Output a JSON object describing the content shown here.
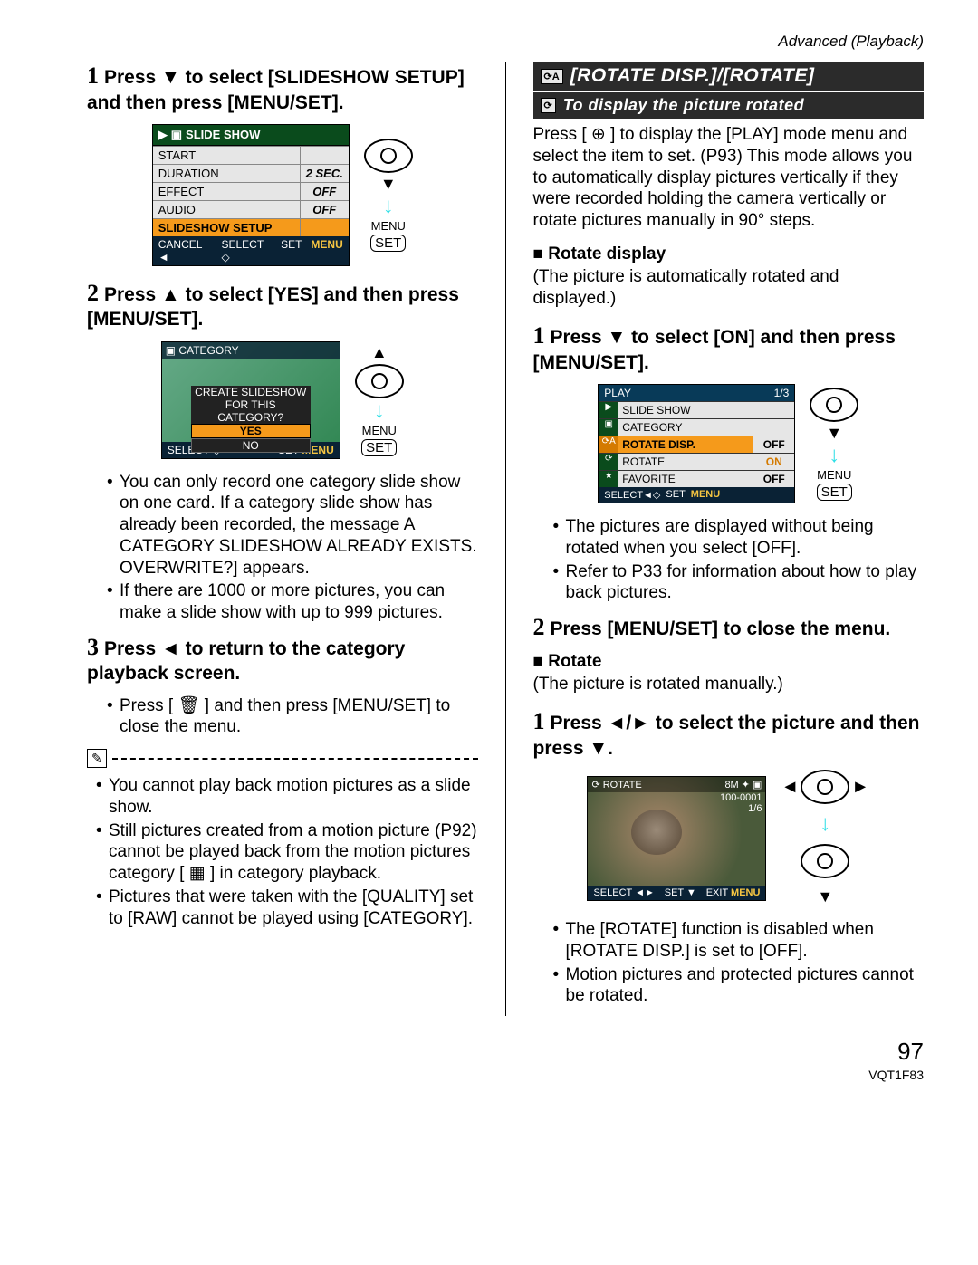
{
  "header": {
    "section": "Advanced (Playback)"
  },
  "left": {
    "step1": "Press ▼ to select [SLIDESHOW SETUP] and then press [MENU/SET].",
    "step2": "Press ▲ to select [YES] and then press [MENU/SET].",
    "step3": "Press ◄ to return to the category playback screen.",
    "bullets_a": [
      "You can only record one category slide show on one card. If a category slide show has already been recorded, the message A CATEGORY SLIDESHOW ALREADY EXISTS. OVERWRITE?] appears.",
      "If there are 1000 or more pictures, you can make a slide show with up to 999 pictures."
    ],
    "bullets_b": [
      "Press [ 🗑 ] and then press [MENU/SET] to close the menu."
    ],
    "notes": [
      "You cannot play back motion pictures as a slide show.",
      "Still pictures created from a motion picture (P92) cannot be played back from the motion pictures category [ ▦ ] in category playback.",
      "Pictures that were taken with the [QUALITY] set to [RAW] cannot be played using [CATEGORY]."
    ],
    "lcd1": {
      "title": "SLIDE SHOW",
      "rows": [
        {
          "label": "START",
          "val": ""
        },
        {
          "label": "DURATION",
          "val": "2 SEC."
        },
        {
          "label": "EFFECT",
          "val": "OFF"
        },
        {
          "label": "AUDIO",
          "val": "OFF"
        },
        {
          "label": "SLIDESHOW SETUP",
          "val": "",
          "sel": true
        }
      ],
      "footer": {
        "cancel": "CANCEL ◄",
        "select": "SELECT ◇",
        "set": "SET"
      }
    },
    "lcd2": {
      "bar": "CATEGORY",
      "prompt1": "CREATE SLIDESHOW",
      "prompt2": "FOR THIS CATEGORY?",
      "yes": "YES",
      "no": "NO",
      "footer": {
        "select": "SELECT ◇",
        "set": "SET"
      }
    },
    "menu_label": "MENU",
    "set_label": "SET"
  },
  "right": {
    "section_title": "[ROTATE DISP.]/[ROTATE]",
    "section_sub": "To display the picture rotated",
    "intro": "Press [ ⊕ ] to display the [PLAY] mode menu and select the item to set. (P93) This mode allows you to automatically display pictures vertically if they were recorded holding the camera vertically or rotate pictures manually in 90° steps.",
    "rotate_disp_head": "Rotate display",
    "rotate_disp_text": "(The picture is automatically rotated and displayed.)",
    "step1": "Press ▼ to select [ON] and then press [MENU/SET].",
    "bullets_a": [
      "The pictures are displayed without being rotated when you select [OFF].",
      "Refer to P33 for information about how to play back pictures."
    ],
    "step2": "Press [MENU/SET] to close the menu.",
    "rotate_head": "Rotate",
    "rotate_text": "(The picture is rotated manually.)",
    "step3": "Press ◄/► to select the picture and then press ▼.",
    "bullets_b": [
      "The [ROTATE] function is disabled when [ROTATE DISP.] is set to [OFF].",
      "Motion pictures and protected pictures cannot be rotated."
    ],
    "lcd3": {
      "title": "PLAY",
      "page": "1/3",
      "rows": [
        {
          "ic": "▶",
          "label": "SLIDE SHOW",
          "val": ""
        },
        {
          "ic": "▣",
          "label": "CATEGORY",
          "val": ""
        },
        {
          "ic": "⟳A",
          "label": "ROTATE DISP.",
          "val": "OFF",
          "sel": true
        },
        {
          "ic": "⟳",
          "label": "ROTATE",
          "val": "ON",
          "onval": true
        },
        {
          "ic": "★",
          "label": "FAVORITE",
          "val": "OFF"
        }
      ],
      "footer": {
        "select": "SELECT◄◇",
        "set": "SET"
      }
    },
    "lcd4": {
      "top_left": "ROTATE",
      "top_right": "8M ✦ ▣",
      "num": "100-0001",
      "idx": "1/6",
      "footer": {
        "select": "SELECT ◄►",
        "set": "SET ▼",
        "exit": "EXIT"
      }
    },
    "menu_label": "MENU",
    "set_label": "SET",
    "icon_labels": {
      "rota": "⟳A",
      "rot": "⟳"
    }
  },
  "footer": {
    "page": "97",
    "code": "VQT1F83"
  }
}
